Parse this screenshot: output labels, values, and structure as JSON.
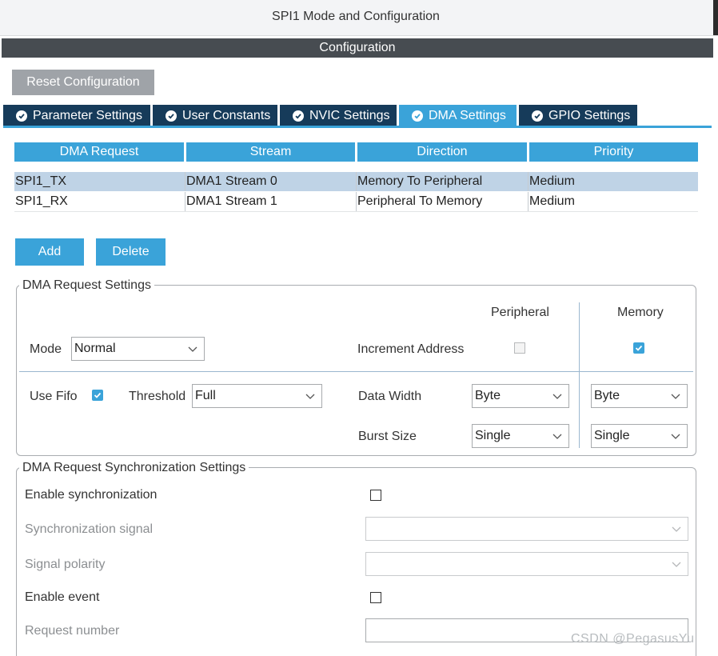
{
  "window": {
    "title": "SPI1 Mode and Configuration"
  },
  "config_header": "Configuration",
  "reset_button": "Reset Configuration",
  "tabs": [
    {
      "label": "Parameter Settings",
      "active": false
    },
    {
      "label": "User Constants",
      "active": false
    },
    {
      "label": "NVIC Settings",
      "active": false
    },
    {
      "label": "DMA Settings",
      "active": true
    },
    {
      "label": "GPIO Settings",
      "active": false
    }
  ],
  "dma_table": {
    "columns": [
      "DMA Request",
      "Stream",
      "Direction",
      "Priority"
    ],
    "rows": [
      {
        "request": "SPI1_TX",
        "stream": "DMA1 Stream 0",
        "direction": "Memory To Peripheral",
        "priority": "Medium",
        "selected": true
      },
      {
        "request": "SPI1_RX",
        "stream": "DMA1 Stream 1",
        "direction": "Peripheral To Memory",
        "priority": "Medium",
        "selected": false
      }
    ]
  },
  "buttons": {
    "add": "Add",
    "delete": "Delete"
  },
  "request_settings": {
    "legend": "DMA Request Settings",
    "peripheral_header": "Peripheral",
    "memory_header": "Memory",
    "mode_label": "Mode",
    "mode_value": "Normal",
    "increment_label": "Increment Address",
    "increment_peripheral": false,
    "increment_memory": true,
    "use_fifo_label": "Use Fifo",
    "use_fifo": true,
    "threshold_label": "Threshold",
    "threshold_value": "Full",
    "data_width_label": "Data Width",
    "data_width_peripheral": "Byte",
    "data_width_memory": "Byte",
    "burst_size_label": "Burst Size",
    "burst_size_peripheral": "Single",
    "burst_size_memory": "Single"
  },
  "sync_settings": {
    "legend": "DMA Request Synchronization Settings",
    "enable_sync_label": "Enable synchronization",
    "enable_sync": false,
    "sync_signal_label": "Synchronization signal",
    "sync_signal_value": "",
    "signal_polarity_label": "Signal polarity",
    "signal_polarity_value": "",
    "enable_event_label": "Enable event",
    "enable_event": false,
    "request_number_label": "Request number",
    "request_number_value": ""
  },
  "watermark": "CSDN @PegasusYu",
  "colors": {
    "accent": "#3aa3d9",
    "tab_dark": "#163b5a",
    "header_dark": "#474c51",
    "selected_row": "#bfd3e6"
  }
}
